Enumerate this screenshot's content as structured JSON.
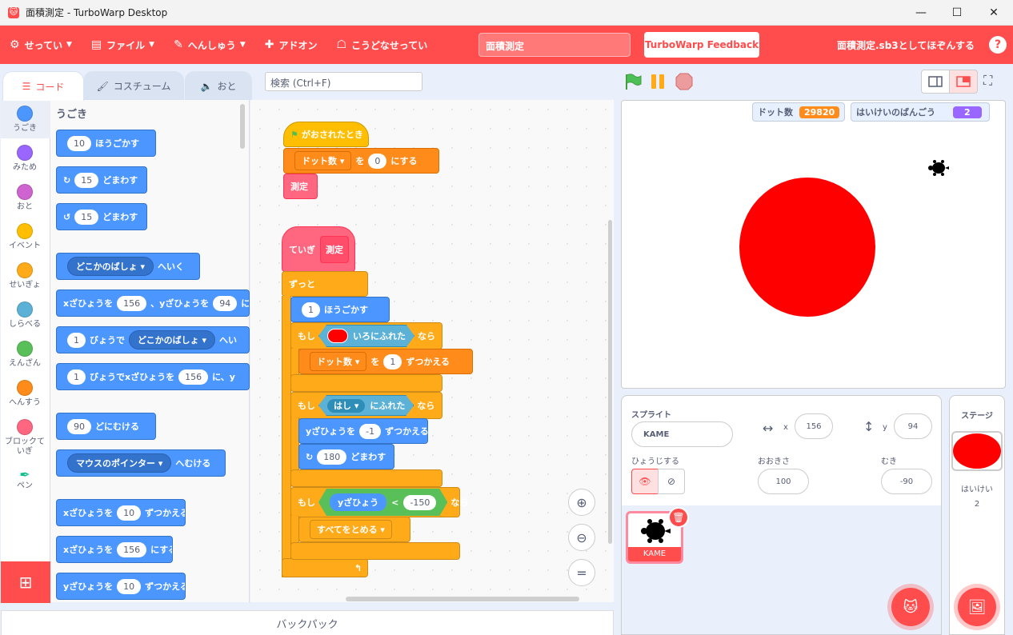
{
  "window": {
    "title": "面積測定 - TurboWarp Desktop",
    "minimize": "—",
    "maximize": "☐",
    "close": "✕",
    "app_icon": "🐱"
  },
  "menu": {
    "settings": "せってい",
    "file": "ファイル",
    "edit": "へんしゅう",
    "addons": "アドオン",
    "advanced": "こうどなせってい",
    "project_title": "面積測定",
    "feedback": "TurboWarp Feedback",
    "save": "面積測定.sb3としてほぞんする",
    "help": "?"
  },
  "tabs": {
    "code": "コード",
    "costume": "コスチューム",
    "sound": "おと"
  },
  "search": {
    "placeholder": "検索 (Ctrl+F)"
  },
  "categories": [
    {
      "label": "うごき",
      "color": "#4c97ff"
    },
    {
      "label": "みため",
      "color": "#9966ff"
    },
    {
      "label": "おと",
      "color": "#cf63cf"
    },
    {
      "label": "イベント",
      "color": "#ffbf00"
    },
    {
      "label": "せいぎょ",
      "color": "#ffab19"
    },
    {
      "label": "しらべる",
      "color": "#5cb1d6"
    },
    {
      "label": "えんざん",
      "color": "#59c059"
    },
    {
      "label": "へんすう",
      "color": "#ff8c1a"
    },
    {
      "label": "ブロックていぎ",
      "color": "#ff6680"
    },
    {
      "label": "ペン",
      "color": "#0fbd8c"
    }
  ],
  "flyout": {
    "section": "うごき",
    "b1": {
      "v": "10",
      "t": "ほうごかす"
    },
    "b2": {
      "v": "15",
      "t": "どまわす"
    },
    "b3": {
      "v": "15",
      "t": "どまわす"
    },
    "b4": {
      "d": "どこかのばしょ",
      "t": "へいく"
    },
    "b5": {
      "a": "xざひょうを",
      "v1": "156",
      "b": "、yざひょうを",
      "v2": "94",
      "c": "にす"
    },
    "b6": {
      "v": "1",
      "a": "びょうで",
      "d": "どこかのばしょ",
      "t": "へい"
    },
    "b7": {
      "v": "1",
      "a": "びょうでxざひょうを",
      "v2": "156",
      "t": "に、y"
    },
    "b8": {
      "v": "90",
      "t": "どにむける"
    },
    "b9": {
      "d": "マウスのポインター",
      "t": "へむける"
    },
    "b10": {
      "a": "xざひょうを",
      "v": "10",
      "t": "ずつかえる"
    },
    "b11": {
      "a": "xざひょうを",
      "v": "156",
      "t": "にする"
    },
    "b12": {
      "a": "yざひょうを",
      "v": "10",
      "t": "ずつかえる"
    }
  },
  "script": {
    "hat": "がおされたとき",
    "set_var": "ドット数",
    "set_wo": "を",
    "set_val": "0",
    "set_suffix": "にする",
    "call": "測定",
    "define": "ていぎ",
    "define_name": "測定",
    "forever": "ずっと",
    "move_val": "1",
    "move_txt": "ほうごかす",
    "if1": "もし",
    "touch_color": "いろにふれた",
    "then1": "なら",
    "change_var": "ドット数",
    "change_wo": "を",
    "change_val": "1",
    "change_suffix": "ずつかえる",
    "if2": "もし",
    "edge": "はし",
    "touch": "にふれた",
    "then2": "なら",
    "change_y": "yざひょうを",
    "change_y_val": "-1",
    "change_y_suffix": "ずつかえる",
    "turn_val": "180",
    "turn_txt": "どまわす",
    "if3": "もし",
    "ypos": "yざひょう",
    "lt": "<",
    "lt_val": "-150",
    "then3": "なら",
    "stop": "すべてをとめる"
  },
  "backpack": "バックパック",
  "monitors": [
    {
      "label": "ドット数",
      "value": "29820",
      "color": "#ff8c1a"
    },
    {
      "label": "はいけいのばんごう",
      "value": "2",
      "color": "#9966ff"
    }
  ],
  "sprite": {
    "heading": "スプライト",
    "name": "KAME",
    "x_label": "x",
    "x": "156",
    "y_label": "y",
    "y": "94",
    "show_label": "ひょうじする",
    "size_label": "おおきさ",
    "size": "100",
    "dir_label": "むき",
    "direction": "-90",
    "thumb_name": "KAME"
  },
  "stage_panel": {
    "heading": "ステージ",
    "backdrop_label": "はいけい",
    "backdrop_num": "2"
  },
  "colors": {
    "accent": "#ff4c4c",
    "circle": "#ff0000"
  }
}
